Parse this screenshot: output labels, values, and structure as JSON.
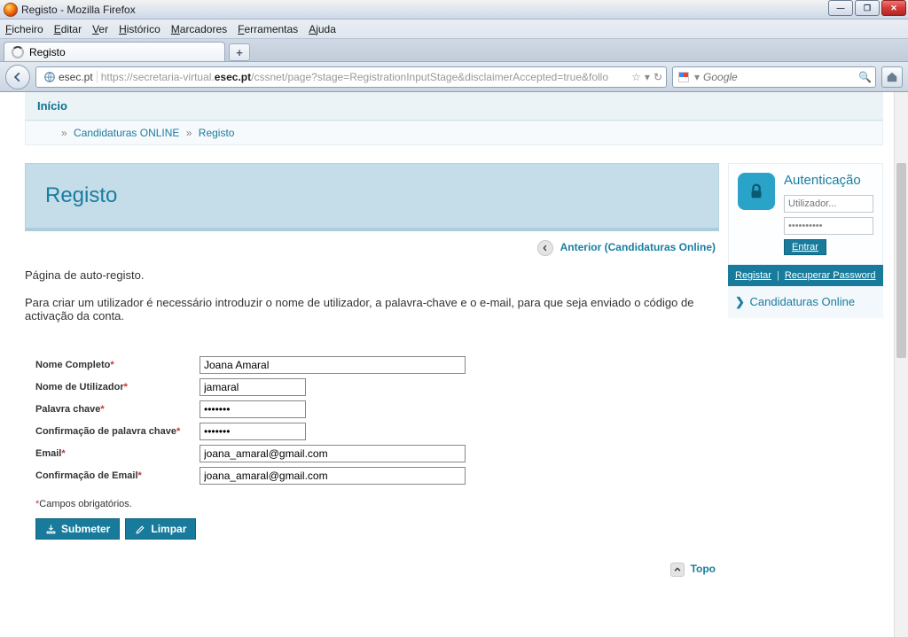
{
  "window": {
    "title": "Registo - Mozilla Firefox"
  },
  "menu": {
    "file": "Ficheiro",
    "edit": "Editar",
    "view": "Ver",
    "history": "Histórico",
    "bookmarks": "Marcadores",
    "tools": "Ferramentas",
    "help": "Ajuda"
  },
  "tab": {
    "title": "Registo",
    "newtab": "+"
  },
  "url": {
    "site_id": "esec.pt",
    "prefix": "https://secretaria-virtual.",
    "bold": "esec.pt",
    "suffix": "/cssnet/page?stage=RegistrationInputStage&disclaimerAccepted=true&follo"
  },
  "search": {
    "placeholder": "Google"
  },
  "nav": {
    "inicio": "Início"
  },
  "breadcrumb": {
    "a": "Candidaturas ONLINE",
    "b": "Registo"
  },
  "page": {
    "title": "Registo",
    "anterior": "Anterior (Candidaturas Online)",
    "intro1": "Página de auto-registo.",
    "intro2": "Para criar um utilizador é necessário introduzir o nome de utilizador, a palavra-chave e o e-mail, para que seja enviado o código de activação da conta.",
    "req_note": "Campos obrigatórios.",
    "topo": "Topo"
  },
  "form": {
    "labels": {
      "nome_completo": "Nome Completo",
      "nome_utilizador": "Nome de Utilizador",
      "palavra_chave": "Palavra chave",
      "confirma_chave": "Confirmação de palavra chave",
      "email": "Email",
      "confirma_email": "Confirmação de Email"
    },
    "values": {
      "nome_completo": "Joana Amaral",
      "nome_utilizador": "jamaral",
      "palavra_chave": "•••••••",
      "confirma_chave": "•••••••",
      "email": "joana_amaral@gmail.com",
      "confirma_email": "joana_amaral@gmail.com"
    },
    "buttons": {
      "submeter": "Submeter",
      "limpar": "Limpar"
    }
  },
  "auth": {
    "title": "Autenticação",
    "user_placeholder": "Utilizador...",
    "pass_value": "••••••••••",
    "entrar": "Entrar",
    "registar": "Registar",
    "recuperar": "Recuperar Password",
    "candidaturas": "Candidaturas Online"
  }
}
